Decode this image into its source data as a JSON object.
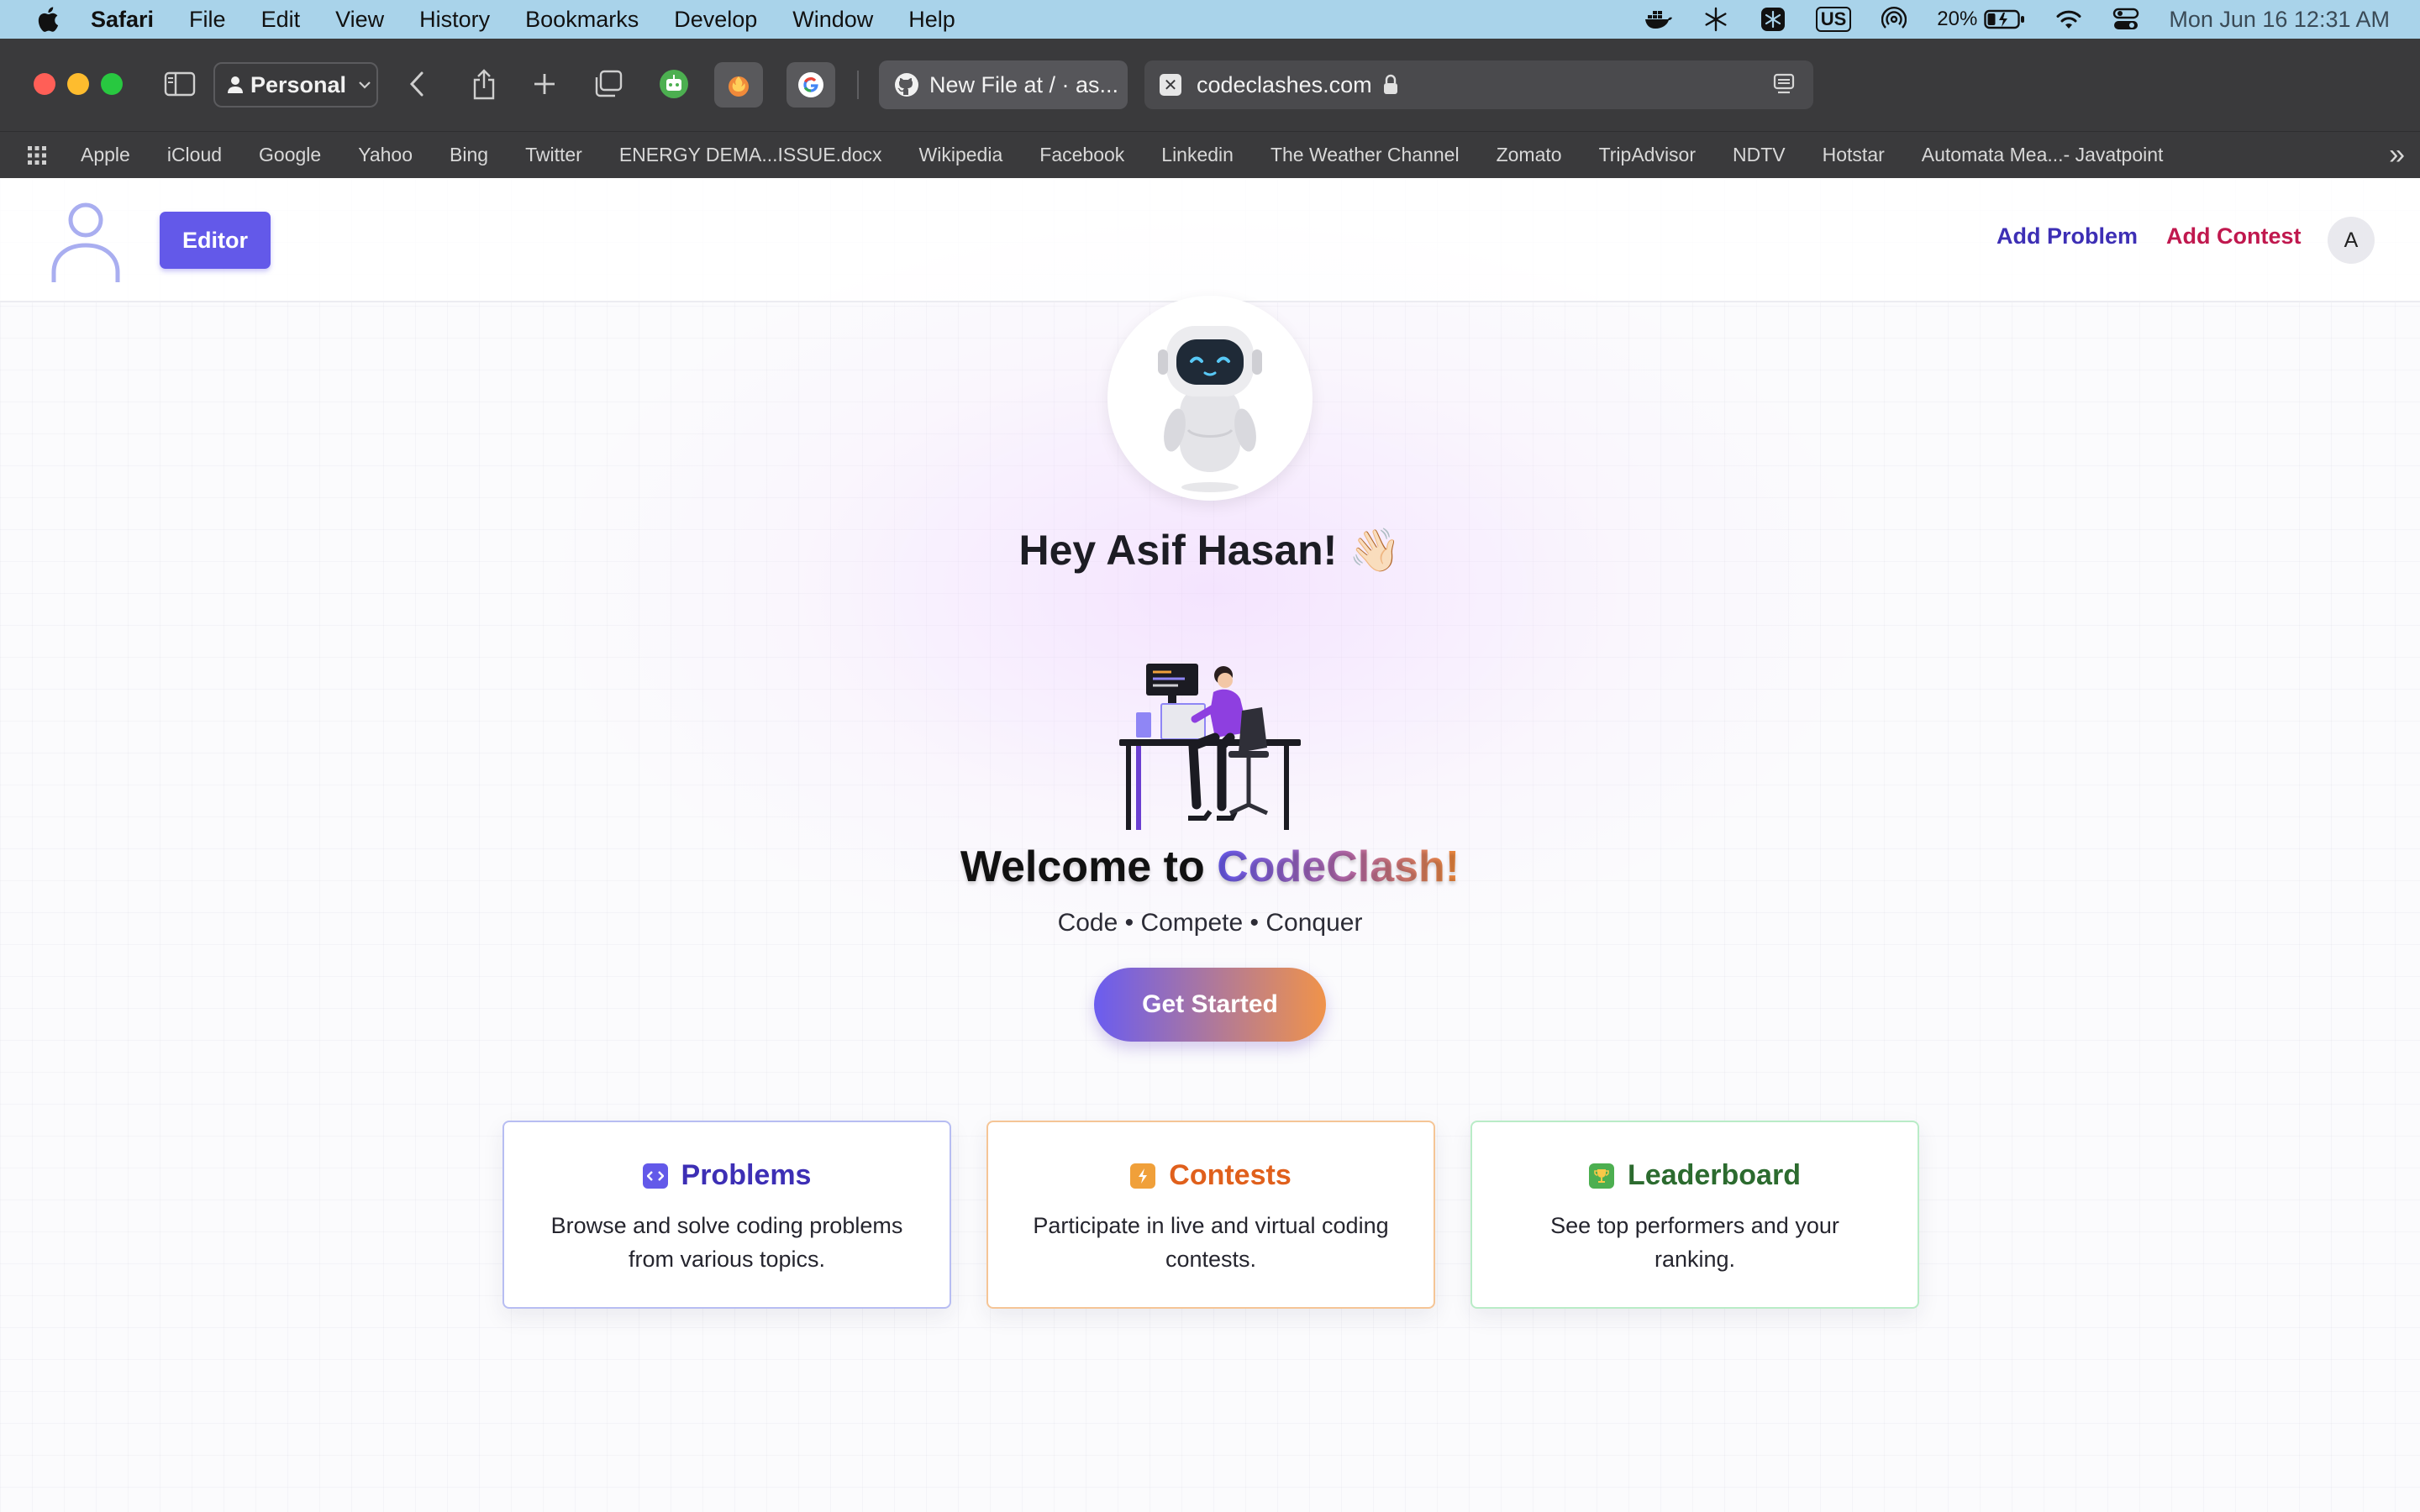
{
  "menubar": {
    "app": "Safari",
    "items": [
      "File",
      "Edit",
      "View",
      "History",
      "Bookmarks",
      "Develop",
      "Window",
      "Help"
    ],
    "input_source": "US",
    "battery": "20%",
    "clock": "Mon Jun 16  12:31 AM"
  },
  "toolbar": {
    "profile": "Personal",
    "tabs": [
      {
        "title": "New File at / · as...",
        "icon": "github-icon"
      },
      {
        "title": "codeclashes.com",
        "icon": "close-icon",
        "active": true
      }
    ]
  },
  "bookmarks": [
    "Apple",
    "iCloud",
    "Google",
    "Yahoo",
    "Bing",
    "Twitter",
    "ENERGY DEMA...ISSUE.docx",
    "Wikipedia",
    "Facebook",
    "Linkedin",
    "The Weather Channel",
    "Zomato",
    "TripAdvisor",
    "NDTV",
    "Hotstar",
    "Automata Mea...- Javatpoint"
  ],
  "header": {
    "editor_label": "Editor",
    "add_problem": "Add Problem",
    "add_contest": "Add Contest",
    "avatar_letter": "A"
  },
  "hero": {
    "greeting": "Hey Asif Hasan! 👋🏻",
    "welcome_prefix": "Welcome to ",
    "brand": "CodeClash!",
    "tagline": "Code • Compete • Conquer",
    "cta": "Get Started"
  },
  "cards": [
    {
      "title": "Problems",
      "icon": "code-icon",
      "desc": "Browse and solve coding problems from various topics.",
      "color": "#3d2fb5",
      "icon_bg": "#6359e9"
    },
    {
      "title": "Contests",
      "icon": "lightning-icon",
      "desc": "Participate in live and virtual coding contests.",
      "color": "#e0601c",
      "icon_bg": "#f0a03a"
    },
    {
      "title": "Leaderboard",
      "icon": "trophy-icon",
      "desc": "See top performers and your ranking.",
      "color": "#2c6b2f",
      "icon_bg": "#4caf50"
    }
  ]
}
